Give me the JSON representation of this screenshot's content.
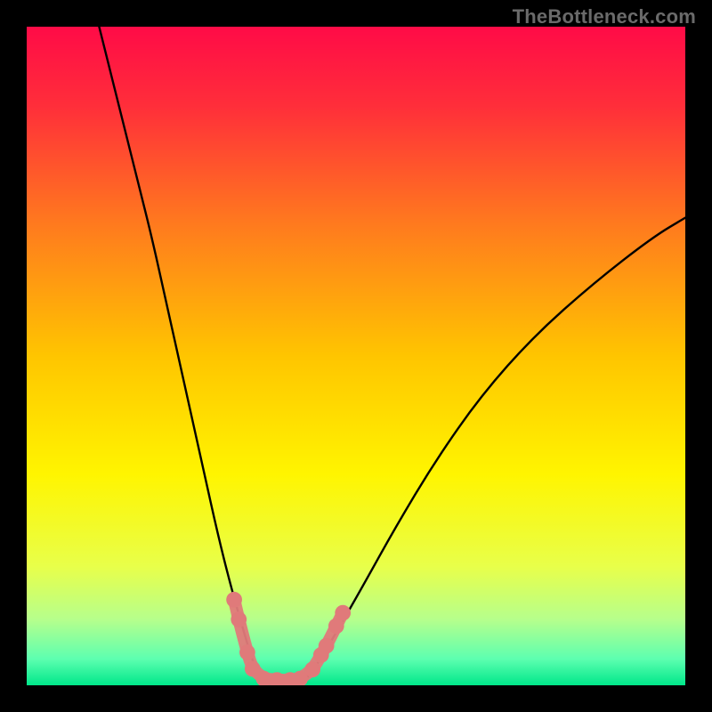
{
  "watermark": "TheBottleneck.com",
  "chart_data": {
    "type": "line",
    "title": "",
    "xlabel": "",
    "ylabel": "",
    "xlim": [
      0,
      100
    ],
    "ylim": [
      0,
      100
    ],
    "grid": false,
    "background_gradient": {
      "type": "vertical-rainbow",
      "stops": [
        {
          "pos": 0.0,
          "color": "#ff0b47"
        },
        {
          "pos": 0.12,
          "color": "#ff2e3a"
        },
        {
          "pos": 0.3,
          "color": "#ff7a1e"
        },
        {
          "pos": 0.5,
          "color": "#ffc500"
        },
        {
          "pos": 0.68,
          "color": "#fff500"
        },
        {
          "pos": 0.82,
          "color": "#e8ff4a"
        },
        {
          "pos": 0.9,
          "color": "#b6ff8c"
        },
        {
          "pos": 0.96,
          "color": "#5dffb0"
        },
        {
          "pos": 1.0,
          "color": "#00e78a"
        }
      ]
    },
    "series": [
      {
        "name": "left-branch",
        "color": "#000000",
        "x": [
          11,
          13,
          15,
          17,
          19,
          21,
          23,
          25,
          27,
          29,
          31,
          33,
          34.5,
          36
        ],
        "y": [
          100,
          92,
          84,
          76,
          68,
          59,
          50,
          41,
          32,
          23,
          15,
          8,
          3,
          0.5
        ]
      },
      {
        "name": "valley-floor",
        "color": "#000000",
        "x": [
          36,
          40,
          42
        ],
        "y": [
          0.5,
          0.5,
          0.5
        ]
      },
      {
        "name": "right-branch",
        "color": "#000000",
        "x": [
          42,
          44,
          47,
          51,
          56,
          62,
          69,
          77,
          86,
          95,
          100
        ],
        "y": [
          0.5,
          3,
          8,
          15,
          24,
          34,
          44,
          53,
          61,
          68,
          71
        ]
      }
    ],
    "markers": {
      "name": "highlight-points",
      "color": "#e07a7a",
      "radius": 1.2,
      "points": [
        {
          "x": 31.5,
          "y": 13
        },
        {
          "x": 32.2,
          "y": 10
        },
        {
          "x": 33.5,
          "y": 5
        },
        {
          "x": 34.3,
          "y": 2.5
        },
        {
          "x": 36.0,
          "y": 1.0
        },
        {
          "x": 38.0,
          "y": 0.8
        },
        {
          "x": 40.0,
          "y": 0.8
        },
        {
          "x": 41.5,
          "y": 1.0
        },
        {
          "x": 43.4,
          "y": 2.4
        },
        {
          "x": 44.7,
          "y": 4.6
        },
        {
          "x": 45.5,
          "y": 6.0
        },
        {
          "x": 47.0,
          "y": 9.0
        },
        {
          "x": 48.0,
          "y": 11.0
        }
      ]
    }
  }
}
